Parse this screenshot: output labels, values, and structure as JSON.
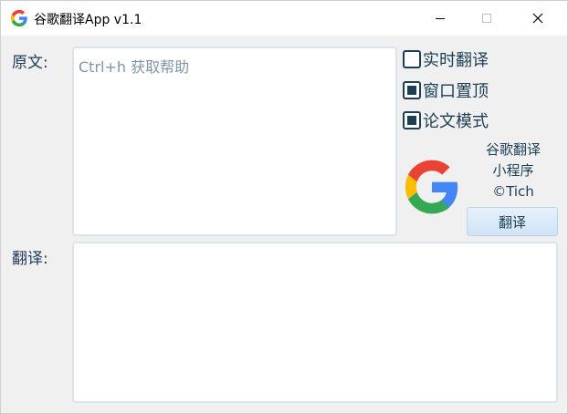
{
  "window": {
    "title": "谷歌翻译App v1.1"
  },
  "labels": {
    "source": "原文:",
    "target": "翻译:"
  },
  "source_input": {
    "placeholder": "Ctrl+h 获取帮助",
    "value": ""
  },
  "target_output": {
    "value": ""
  },
  "options": [
    {
      "label": "实时翻译",
      "checked": false
    },
    {
      "label": "窗口置顶",
      "checked": true
    },
    {
      "label": "论文模式",
      "checked": true
    }
  ],
  "about": {
    "line1": "谷歌翻译",
    "line2": "小程序",
    "line3": "©Tich"
  },
  "translate_button": {
    "label": "翻译"
  },
  "icons": {
    "app": "google-g-icon",
    "logo": "google-g-icon",
    "minimize": "minimize-icon",
    "maximize": "maximize-icon",
    "close": "close-icon"
  },
  "colors": {
    "text": "#1c3f55",
    "placeholder": "#7f96a6",
    "google_blue": "#4285f4",
    "google_red": "#ea4335",
    "google_yellow": "#fbbc05",
    "google_green": "#34a853"
  }
}
